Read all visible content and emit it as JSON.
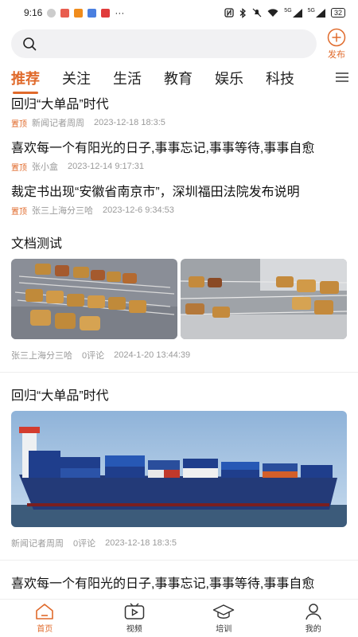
{
  "status_bar": {
    "time": "9:16",
    "more": "···",
    "signal_1": "5G",
    "signal_2": "5G",
    "battery": "32"
  },
  "search": {
    "placeholder": "",
    "publish_label": "发布"
  },
  "tabs": [
    {
      "label": "推荐",
      "active": true
    },
    {
      "label": "关注"
    },
    {
      "label": "生活"
    },
    {
      "label": "教育"
    },
    {
      "label": "娱乐"
    },
    {
      "label": "科技"
    }
  ],
  "pinned": [
    {
      "title": "回归“大单品”时代",
      "badge": "置顶",
      "author": "新闻记者周周",
      "time": "2023-12-18 18:3:5"
    },
    {
      "title": "喜欢每一个有阳光的日子,事事忘记,事事等待,事事自愈",
      "badge": "置顶",
      "author": "张小盒",
      "time": "2023-12-14 9:17:31"
    },
    {
      "title": "裁定书出现“安徽省南京市”，深圳福田法院发布说明",
      "badge": "置顶",
      "author": "张三上海分三哈",
      "time": "2023-12-6 9:34:53"
    }
  ],
  "articles": [
    {
      "title": "文档测试",
      "author": "张三上海分三哈",
      "comments": "0评论",
      "time": "2024-1-20 13:44:39"
    },
    {
      "title": "回归“大单品”时代",
      "author": "新闻记者周周",
      "comments": "0评论",
      "time": "2023-12-18 18:3:5"
    },
    {
      "title": "喜欢每一个有阳光的日子,事事忘记,事事等待,事事自愈"
    }
  ],
  "tabbar": [
    {
      "label": "首页",
      "icon": "home-icon",
      "active": true
    },
    {
      "label": "视频",
      "icon": "video-icon"
    },
    {
      "label": "培训",
      "icon": "graduation-cap-icon"
    },
    {
      "label": "我的",
      "icon": "user-icon"
    }
  ],
  "colors": {
    "accent": "#e06a2b"
  }
}
